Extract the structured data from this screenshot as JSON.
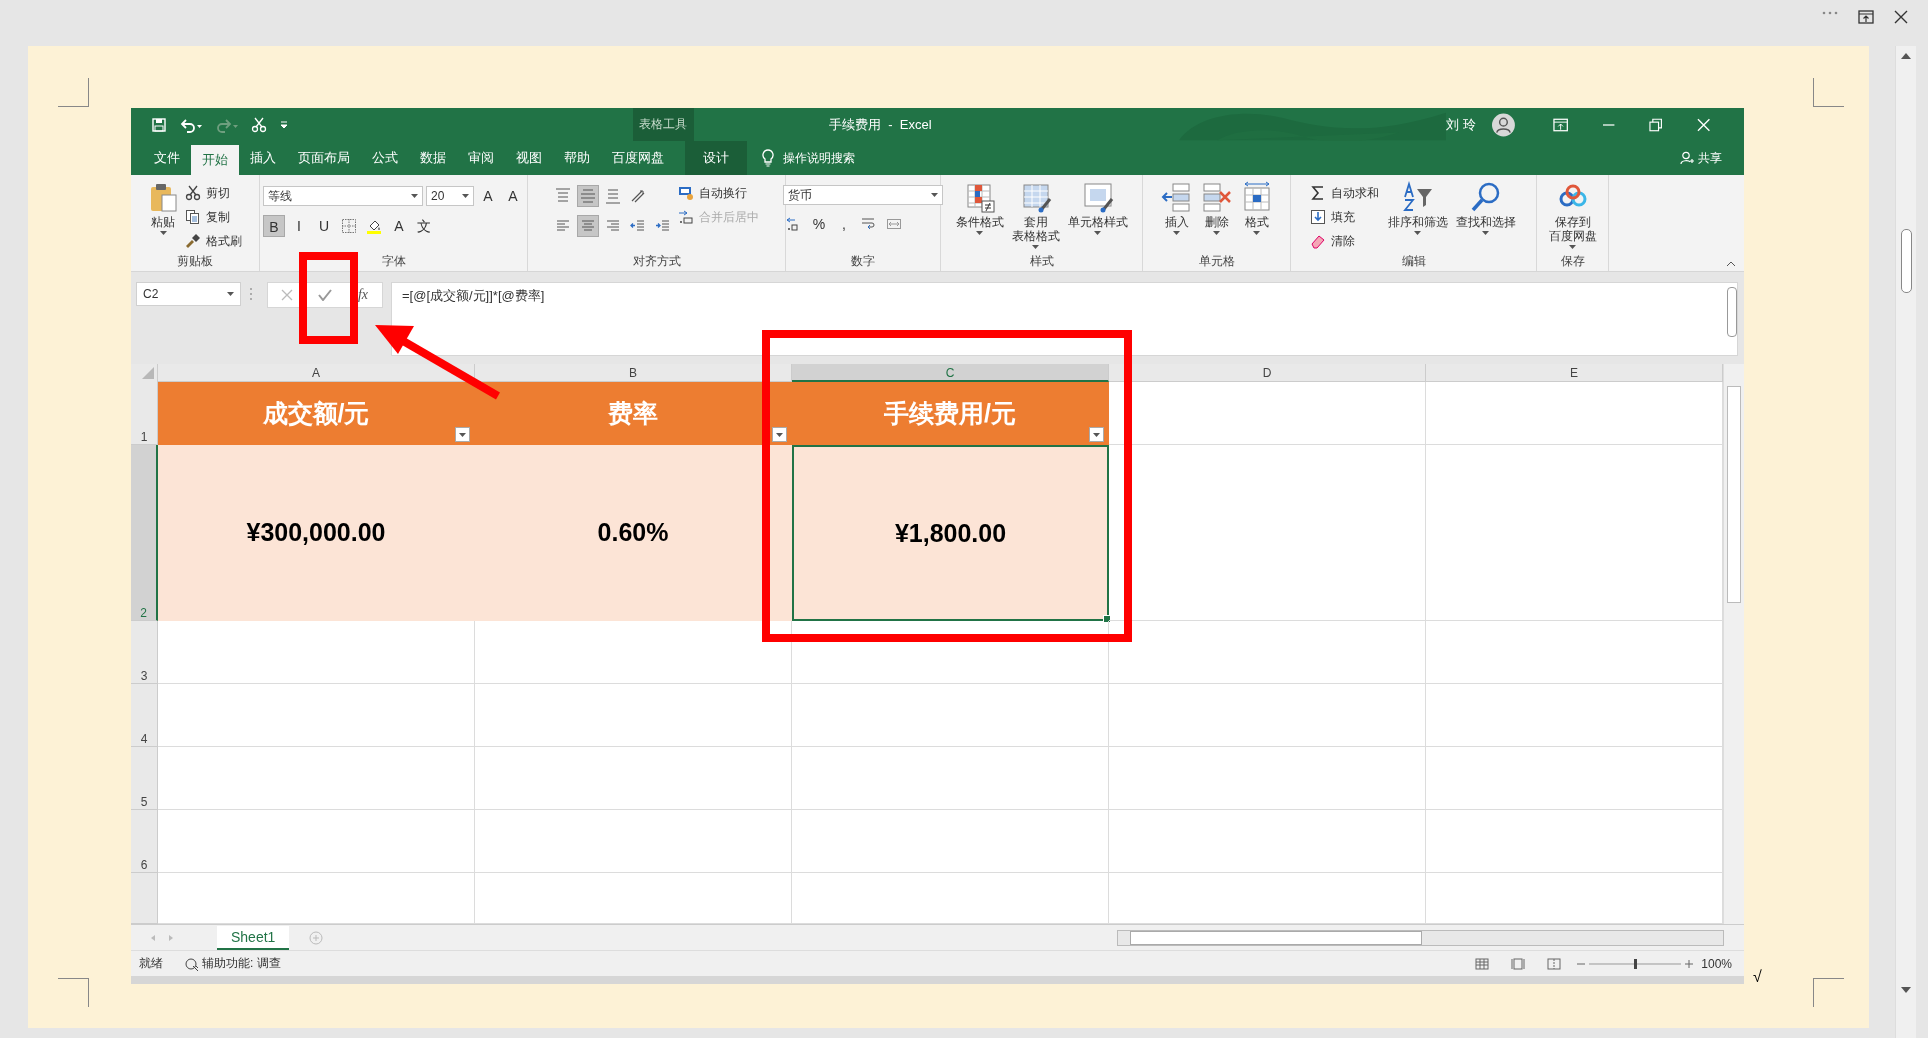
{
  "document": {
    "cursor_text": "√"
  },
  "annotations": [
    {
      "kind": "box"
    },
    {
      "kind": "box"
    },
    {
      "kind": "arrow"
    }
  ],
  "excel": {
    "title_bar": {
      "context_label": "表格工具",
      "title": "手续费用  -  Excel",
      "user": "刘 玲"
    },
    "tabs": [
      {
        "label": "文件",
        "selected": false,
        "kind": "normal"
      },
      {
        "label": "开始",
        "selected": true,
        "kind": "normal"
      },
      {
        "label": "插入",
        "selected": false,
        "kind": "normal"
      },
      {
        "label": "页面布局",
        "selected": false,
        "kind": "normal"
      },
      {
        "label": "公式",
        "selected": false,
        "kind": "normal"
      },
      {
        "label": "数据",
        "selected": false,
        "kind": "normal"
      },
      {
        "label": "审阅",
        "selected": false,
        "kind": "normal"
      },
      {
        "label": "视图",
        "selected": false,
        "kind": "normal"
      },
      {
        "label": "帮助",
        "selected": false,
        "kind": "normal"
      },
      {
        "label": "百度网盘",
        "selected": false,
        "kind": "normal"
      },
      {
        "label": "设计",
        "selected": false,
        "kind": "context"
      }
    ],
    "tell_me": "操作说明搜索",
    "share": "共享",
    "ribbon": [
      {
        "label": "剪贴板",
        "blocks": [
          {
            "kind": "large",
            "label": "粘贴"
          },
          {
            "kind": "stack",
            "items": [
              {
                "label": "剪切",
                "disabled": false
              },
              {
                "label": "复制",
                "disabled": false
              },
              {
                "label": "格式刷",
                "disabled": false
              }
            ]
          }
        ]
      },
      {
        "label": "字体",
        "blocks": [
          {
            "kind": "rows",
            "rows": [
              [
                {
                  "kind": "combo",
                  "label": "等线"
                },
                {
                  "kind": "combo",
                  "label": "20"
                },
                {
                  "kind": "glyph",
                  "label": "A",
                  "selected": false
                },
                {
                  "kind": "glyph",
                  "label": "A",
                  "selected": false
                }
              ],
              [
                {
                  "kind": "glyph",
                  "label": "B",
                  "selected": true
                },
                {
                  "kind": "glyph",
                  "label": "I",
                  "selected": false
                },
                {
                  "kind": "glyph",
                  "label": "U",
                  "selected": false
                },
                {
                  "kind": "icon",
                  "selected": false
                },
                {
                  "kind": "icon",
                  "selected": false
                },
                {
                  "kind": "glyph",
                  "label": "A",
                  "selected": false
                },
                {
                  "kind": "glyph",
                  "label": "文",
                  "selected": false
                }
              ]
            ]
          }
        ]
      },
      {
        "label": "对齐方式",
        "blocks": [
          {
            "kind": "rows",
            "rows": [
              [
                {
                  "kind": "icon",
                  "selected": false
                },
                {
                  "kind": "icon",
                  "selected": true
                },
                {
                  "kind": "icon",
                  "selected": false
                },
                {
                  "kind": "icon",
                  "selected": false
                }
              ],
              [
                {
                  "kind": "icon",
                  "selected": false
                },
                {
                  "kind": "icon",
                  "selected": true
                },
                {
                  "kind": "icon",
                  "selected": false
                },
                {
                  "kind": "icon",
                  "selected": false
                },
                {
                  "kind": "icon",
                  "selected": false
                }
              ]
            ]
          },
          {
            "kind": "stack",
            "items": [
              {
                "label": "自动换行",
                "disabled": false
              },
              {
                "label": "合并后居中",
                "disabled": true
              }
            ]
          }
        ]
      },
      {
        "label": "数字",
        "blocks": [
          {
            "kind": "rows",
            "rows": [
              [
                {
                  "kind": "combo",
                  "label": "货币"
                }
              ],
              [
                {
                  "kind": "icon",
                  "selected": false
                },
                {
                  "kind": "glyph",
                  "label": "%",
                  "selected": false
                },
                {
                  "kind": "glyph",
                  "label": ",",
                  "selected": false
                },
                {
                  "kind": "icon",
                  "selected": false
                },
                {
                  "kind": "icon",
                  "selected": false
                }
              ]
            ]
          }
        ]
      },
      {
        "label": "样式",
        "blocks": [
          {
            "kind": "large",
            "label": "条件格式"
          },
          {
            "kind": "large",
            "label_lines": [
              "套用",
              "表格格式"
            ]
          },
          {
            "kind": "large",
            "label": "单元格样式"
          }
        ]
      },
      {
        "label": "单元格",
        "blocks": [
          {
            "kind": "large",
            "label": "插入"
          },
          {
            "kind": "large",
            "label": "删除"
          },
          {
            "kind": "large",
            "label": "格式"
          }
        ]
      },
      {
        "label": "编辑",
        "blocks": [
          {
            "kind": "stack",
            "items": [
              {
                "label": "自动求和",
                "disabled": false
              },
              {
                "label": "填充",
                "disabled": false
              },
              {
                "label": "清除",
                "disabled": false
              }
            ]
          },
          {
            "kind": "large",
            "label": "排序和筛选"
          },
          {
            "kind": "large",
            "label": "查找和选择"
          }
        ]
      },
      {
        "label": "保存",
        "blocks": [
          {
            "kind": "large",
            "label_lines": [
              "保存到",
              "百度网盘"
            ]
          }
        ]
      }
    ],
    "formula_bar": {
      "name_box": "C2",
      "function_label": "fx",
      "formula": "=[@[成交额/元]]*[@费率]"
    },
    "columns": [
      {
        "label": "A",
        "selected": false
      },
      {
        "label": "B",
        "selected": false
      },
      {
        "label": "C",
        "selected": true
      },
      {
        "label": "D",
        "selected": false
      },
      {
        "label": "E",
        "selected": false
      }
    ],
    "rows": [
      {
        "label": "1",
        "selected": false,
        "kind": "header",
        "cells": [
          {
            "text": "成交额/元",
            "filter": true
          },
          {
            "text": "费率",
            "filter": true
          },
          {
            "text": "手续费用/元",
            "filter": true
          }
        ]
      },
      {
        "label": "2",
        "selected": true,
        "kind": "data",
        "cells": [
          {
            "text": "¥300,000.00",
            "selected": false
          },
          {
            "text": "0.60%",
            "selected": false
          },
          {
            "text": "¥1,800.00",
            "selected": true
          }
        ]
      },
      {
        "label": "3",
        "selected": false,
        "kind": "empty"
      },
      {
        "label": "4",
        "selected": false,
        "kind": "empty"
      },
      {
        "label": "5",
        "selected": false,
        "kind": "empty"
      },
      {
        "label": "6",
        "selected": false,
        "kind": "empty"
      }
    ],
    "sheet_tabs": [
      {
        "label": "Sheet1",
        "selected": true
      }
    ],
    "status_bar": {
      "ready": "就绪",
      "accessibility": "辅助功能: 调查",
      "zoom_slider": {
        "level": 0.5
      },
      "zoom": "100%"
    }
  }
}
